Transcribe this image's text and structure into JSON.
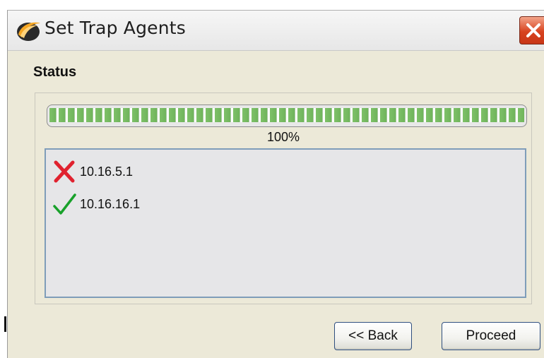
{
  "window": {
    "title": "Set Trap Agents",
    "app_icon": "orange-swoosh-icon",
    "close_icon": "close-icon"
  },
  "status": {
    "label": "Status",
    "progress": {
      "value": 1.0,
      "text": "100%"
    }
  },
  "results": [
    {
      "address": "10.16.5.1",
      "status": "failure",
      "icon": "red-x-icon"
    },
    {
      "address": "10.16.16.1",
      "status": "success",
      "icon": "green-check-icon"
    }
  ],
  "buttons": {
    "back_label": "<< Back",
    "proceed_label": "Proceed"
  },
  "colors": {
    "progress_green": "#6fb45b",
    "failure_red": "#e0222f",
    "success_green": "#18a12a",
    "close_red": "#d8431f"
  }
}
